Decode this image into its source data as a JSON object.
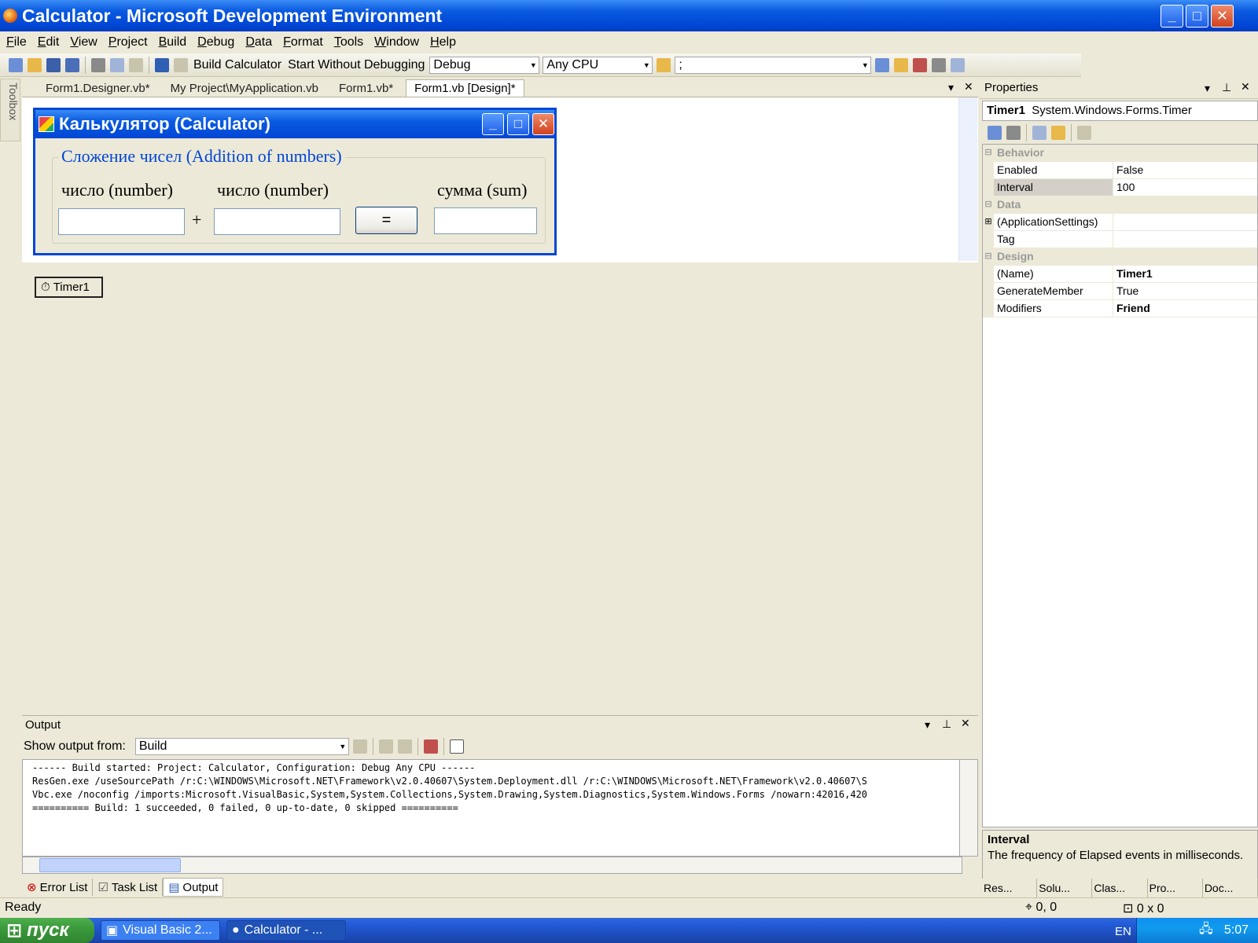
{
  "window": {
    "title": "Calculator - Microsoft Development Environment"
  },
  "menu": [
    "File",
    "Edit",
    "View",
    "Project",
    "Build",
    "Debug",
    "Data",
    "Format",
    "Tools",
    "Window",
    "Help"
  ],
  "toolbar": {
    "build_label": "Build Calculator",
    "start_label": "Start Without Debugging",
    "config": "Debug",
    "platform": "Any CPU",
    "find": ";"
  },
  "toolbox_label": "Toolbox",
  "doc_tabs": [
    "Form1.Designer.vb*",
    "My Project\\MyApplication.vb",
    "Form1.vb*",
    "Form1.vb [Design]*"
  ],
  "form": {
    "title": "Калькулятор (Calculator)",
    "group": "Сложение чисел (Addition of numbers)",
    "label1": "число (number)",
    "label2": "число (number)",
    "label3": "сумма (sum)",
    "plus": "+",
    "equals": "="
  },
  "component_tray": {
    "timer": "Timer1"
  },
  "properties": {
    "header": "Properties",
    "object_name": "Timer1",
    "object_type": "System.Windows.Forms.Timer",
    "rows": [
      {
        "type": "cat",
        "name": "Behavior"
      },
      {
        "type": "prop",
        "name": "Enabled",
        "value": "False"
      },
      {
        "type": "prop",
        "name": "Interval",
        "value": "100",
        "selected": true
      },
      {
        "type": "cat",
        "name": "Data"
      },
      {
        "type": "prop",
        "name": "(ApplicationSettings)",
        "value": "",
        "expand": "+"
      },
      {
        "type": "prop",
        "name": "Tag",
        "value": ""
      },
      {
        "type": "cat",
        "name": "Design"
      },
      {
        "type": "prop",
        "name": "(Name)",
        "value": "Timer1",
        "bold": true
      },
      {
        "type": "prop",
        "name": "GenerateMember",
        "value": "True"
      },
      {
        "type": "prop",
        "name": "Modifiers",
        "value": "Friend",
        "bold": true
      }
    ],
    "desc_title": "Interval",
    "desc_text": "The frequency of Elapsed events in milliseconds.",
    "bottom_tabs": [
      "Res...",
      "Solu...",
      "Clas...",
      "Pro...",
      "Doc..."
    ]
  },
  "output": {
    "header": "Output",
    "show_from_label": "Show output from:",
    "source": "Build",
    "lines": [
      "------ Build started: Project: Calculator, Configuration: Debug Any CPU ------",
      "ResGen.exe /useSourcePath /r:C:\\WINDOWS\\Microsoft.NET\\Framework\\v2.0.40607\\System.Deployment.dll /r:C:\\WINDOWS\\Microsoft.NET\\Framework\\v2.0.40607\\S",
      "Vbc.exe /noconfig /imports:Microsoft.VisualBasic,System,System.Collections,System.Drawing,System.Diagnostics,System.Windows.Forms /nowarn:42016,420",
      "========== Build: 1 succeeded, 0 failed, 0 up-to-date, 0 skipped =========="
    ]
  },
  "bottom_tabs": [
    "Error List",
    "Task List",
    "Output"
  ],
  "status": {
    "text": "Ready",
    "pos": "0, 0",
    "size": "0 x 0"
  },
  "taskbar": {
    "start": "пуск",
    "tasks": [
      "Visual Basic 2...",
      "Calculator - ..."
    ],
    "lang": "EN",
    "clock": "5:07"
  },
  "colors": {
    "xp_blue": "#0046D5",
    "chrome": "#ECE9D8",
    "start_green": "#3c9a3c"
  }
}
